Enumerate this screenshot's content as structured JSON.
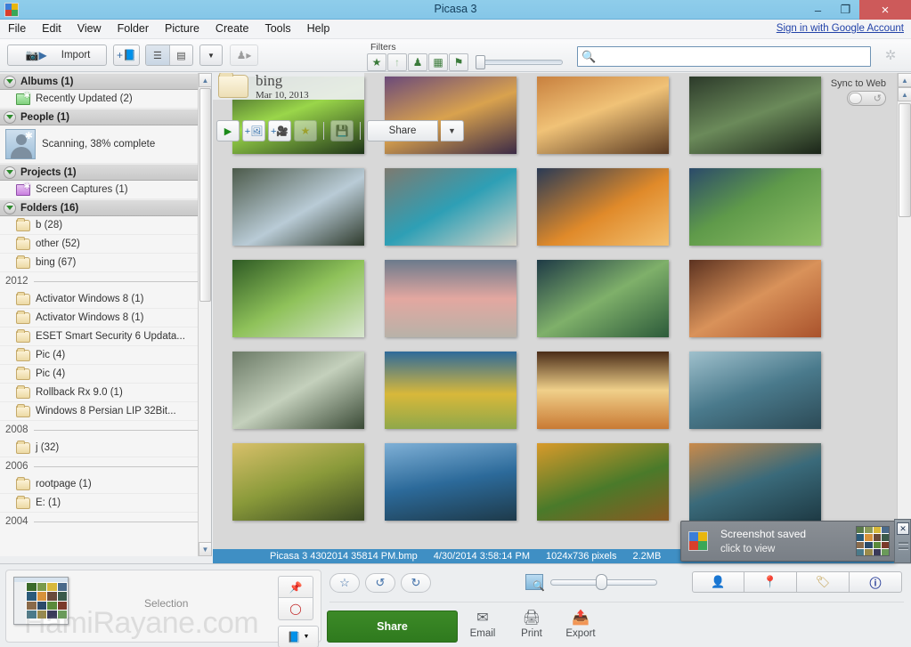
{
  "window": {
    "title": "Picasa 3",
    "app_icon": "picasa-logo-icon",
    "minimize": "–",
    "maximize": "❐",
    "close": "×"
  },
  "menubar": {
    "items": [
      "File",
      "Edit",
      "View",
      "Folder",
      "Picture",
      "Create",
      "Tools",
      "Help"
    ],
    "signin_link": "Sign in with Google Account"
  },
  "toolbar": {
    "import_label": "Import",
    "import_icon": "camera-import-icon",
    "add_album_icon": "add-album-icon",
    "view_list_icon": "list-view-icon",
    "view_detail_icon": "detail-view-icon",
    "dropdown_icon": "chevron-down-icon",
    "people_icon": "people-icon",
    "filters_label": "Filters",
    "filter_buttons": [
      {
        "name": "star-filter",
        "glyph": "★"
      },
      {
        "name": "upload-filter",
        "glyph": "↑"
      },
      {
        "name": "faces-filter",
        "glyph": "♟"
      },
      {
        "name": "movies-filter",
        "glyph": "▦"
      },
      {
        "name": "geotag-filter",
        "glyph": "⚑"
      }
    ],
    "search": {
      "placeholder": "",
      "value": "",
      "icon": "search-magnifier-icon"
    },
    "spinner_icon": "loading-spinner-icon"
  },
  "sidebar": {
    "sections": [
      {
        "name": "albums",
        "header": "Albums (1)",
        "items": [
          {
            "label": "Recently Updated (2)",
            "icon": "album-icon"
          }
        ]
      },
      {
        "name": "people",
        "header": "People (1)",
        "items": [
          {
            "label": "Scanning, 38% complete",
            "icon": "person-avatar-icon"
          }
        ]
      },
      {
        "name": "projects",
        "header": "Projects (1)",
        "items": [
          {
            "label": "Screen Captures (1)",
            "icon": "project-icon"
          }
        ]
      },
      {
        "name": "folders",
        "header": "Folders (16)",
        "items": [
          {
            "label": "b (28)",
            "icon": "folder-icon"
          },
          {
            "label": "other (52)",
            "icon": "folder-icon"
          },
          {
            "label": "bing (67)",
            "icon": "folder-icon"
          }
        ],
        "year_groups": [
          {
            "year": "2012",
            "items": [
              {
                "label": "Activator Windows 8 (1)",
                "icon": "folder-icon"
              },
              {
                "label": "Activator Windows 8 (1)",
                "icon": "folder-icon"
              },
              {
                "label": "ESET Smart Security 6 Updata...",
                "icon": "folder-icon"
              },
              {
                "label": "Pic (4)",
                "icon": "folder-icon"
              },
              {
                "label": "Pic (4)",
                "icon": "folder-icon"
              },
              {
                "label": "Rollback Rx 9.0 (1)",
                "icon": "folder-icon"
              },
              {
                "label": "Windows 8 Persian LIP 32Bit...",
                "icon": "folder-icon"
              }
            ]
          },
          {
            "year": "2008",
            "items": [
              {
                "label": "j (32)",
                "icon": "folder-icon"
              }
            ]
          },
          {
            "year": "2006",
            "items": [
              {
                "label": "rootpage (1)",
                "icon": "folder-icon"
              },
              {
                "label": "E: (1)",
                "icon": "folder-icon"
              }
            ]
          },
          {
            "year": "2004",
            "items": []
          }
        ]
      }
    ]
  },
  "folder_header": {
    "name": "bing",
    "date": "Mar 10, 2013",
    "icon": "big-folder-icon",
    "actions": [
      {
        "name": "play-slideshow-button",
        "glyph": "▶"
      },
      {
        "name": "add-photo-button",
        "glyph": "❑"
      },
      {
        "name": "add-movie-button",
        "glyph": "▦"
      },
      {
        "name": "star-button",
        "glyph": "★"
      },
      {
        "name": "save-button",
        "glyph": "ὋE"
      }
    ],
    "share_label": "Share",
    "share_caret": "▼"
  },
  "sync": {
    "label": "Sync to Web",
    "toggle_state": "off",
    "refresh_icon": "sync-refresh-icon"
  },
  "statusbar": {
    "filename": "Picasa 3 4302014 35814 PM.bmp",
    "timestamp": "4/30/2014 3:58:14 PM",
    "dimensions": "1024x736 pixels",
    "filesize": "2.2MB"
  },
  "bottombar": {
    "selection_label": "Selection",
    "watermark": "HamiRayane.com",
    "selection_thumb_icon": "selection-thumbnail",
    "side_buttons": [
      {
        "name": "hold-pin-button",
        "glyph": "⚑"
      },
      {
        "name": "clear-selection-button",
        "glyph": "◯"
      },
      {
        "name": "album-dropdown-button",
        "glyph": "▼"
      }
    ],
    "edit_buttons": [
      {
        "name": "star-rating-button",
        "glyph": "☆"
      },
      {
        "name": "rotate-left-button",
        "glyph": "↺"
      },
      {
        "name": "rotate-right-button",
        "glyph": "↻"
      }
    ],
    "zoom": {
      "icon": "zoom-thumbnail-icon",
      "value": "50"
    },
    "view_buttons": [
      {
        "name": "people-view-button",
        "glyph": "♟"
      },
      {
        "name": "places-view-button",
        "glyph": "⚑"
      },
      {
        "name": "tags-view-button",
        "glyph": "✐"
      },
      {
        "name": "info-view-button",
        "glyph": "i"
      }
    ],
    "share_big_label": "Share",
    "actions": [
      {
        "name": "email-action",
        "label": "Email",
        "glyph": "✉"
      },
      {
        "name": "print-action",
        "label": "Print",
        "glyph": "⎙"
      },
      {
        "name": "export-action",
        "label": "Export",
        "glyph": "➥"
      }
    ]
  },
  "toast": {
    "title": "Screenshot saved",
    "subtitle": "click to view",
    "icon": "picasa-logo-icon",
    "preview_icon": "screenshot-preview",
    "close_glyph": "✕"
  },
  "photos": {
    "rows": [
      [
        {
          "name": "green-leaves-moss",
          "colors": [
            "#2f4a24",
            "#9ad64a",
            "#1e3318"
          ]
        },
        {
          "name": "canyon-reflection-sunset",
          "colors": [
            "#6b4a7a",
            "#d9a24e",
            "#3b2a46"
          ]
        },
        {
          "name": "desert-sunset-cliffs",
          "colors": [
            "#c8803e",
            "#f0c277",
            "#5a3a22"
          ]
        },
        {
          "name": "dark-green-hills",
          "colors": [
            "#2c3a2a",
            "#6b8a5a",
            "#1a2418"
          ]
        }
      ],
      [
        {
          "name": "coastal-cliff-beach",
          "colors": [
            "#4c5a4a",
            "#b9cbd6",
            "#2e3a2c"
          ]
        },
        {
          "name": "sea-cave-arch",
          "colors": [
            "#7d7a70",
            "#2e9fb5",
            "#d8d4c8"
          ]
        },
        {
          "name": "lake-sunrise-orange",
          "colors": [
            "#e08a2a",
            "#2a3a55",
            "#f2c070"
          ]
        },
        {
          "name": "green-rolling-hills",
          "colors": [
            "#5f9a4a",
            "#2b4a6a",
            "#8fc066"
          ]
        }
      ],
      [
        {
          "name": "waterfall-bridge-forest",
          "colors": [
            "#2e5a24",
            "#8fc25a",
            "#d8e6d0"
          ]
        },
        {
          "name": "pink-sunrise-lake-pebbles",
          "colors": [
            "#e3a7a0",
            "#6b7a8c",
            "#b8b2a8"
          ]
        },
        {
          "name": "alpine-lake-pines",
          "colors": [
            "#2c5a3a",
            "#7fb06a",
            "#1e3a46"
          ]
        },
        {
          "name": "red-rock-canyon",
          "colors": [
            "#a9522c",
            "#d9925a",
            "#5c3220"
          ]
        }
      ],
      [
        {
          "name": "misty-waterfall-forest",
          "colors": [
            "#6b7a66",
            "#c4d0bc",
            "#3a4a36"
          ]
        },
        {
          "name": "yellow-meadow-mountains",
          "colors": [
            "#d8b83a",
            "#2e6a9a",
            "#8fa84a"
          ]
        },
        {
          "name": "desert-arch-sunset",
          "colors": [
            "#c97a34",
            "#f0d08a",
            "#4a2c18"
          ]
        },
        {
          "name": "mountain-lake-alpine",
          "colors": [
            "#4a7a8c",
            "#9fc0cc",
            "#2c4a56"
          ]
        }
      ],
      [
        {
          "name": "golden-valley-hills",
          "colors": [
            "#8a9a3a",
            "#d8c06a",
            "#3a4a22"
          ]
        },
        {
          "name": "blue-lake-mountains-pine",
          "colors": [
            "#2c6a9a",
            "#7fb0d6",
            "#1e3a4a"
          ]
        },
        {
          "name": "autumn-forest-trees",
          "colors": [
            "#d89a2a",
            "#4a7a2a",
            "#8a5a22"
          ]
        },
        {
          "name": "lake-shore-sunset",
          "colors": [
            "#3a6a7a",
            "#c98a4a",
            "#1e3a44"
          ]
        }
      ]
    ]
  }
}
